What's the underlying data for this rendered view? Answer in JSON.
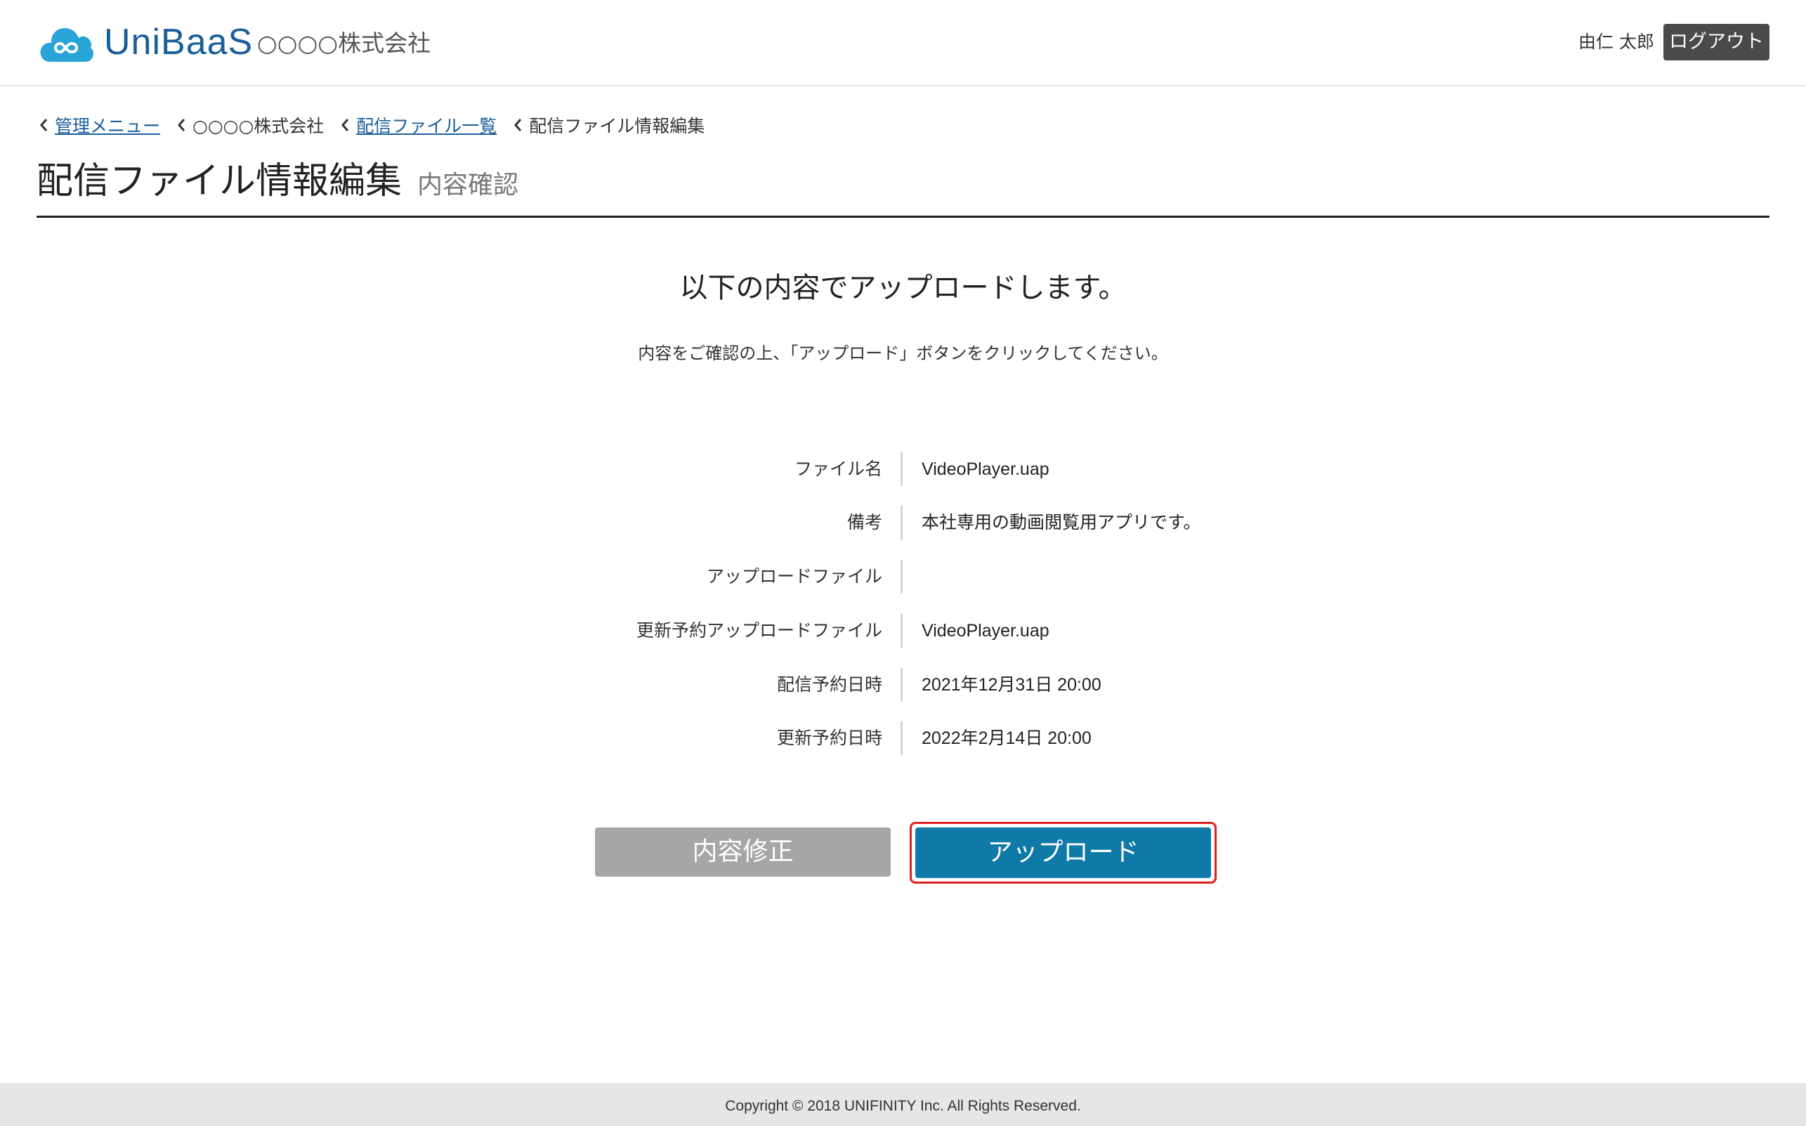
{
  "header": {
    "brand": "UniBaaS",
    "company": "○○○○株式会社",
    "user_name": "由仁 太郎",
    "logout_label": "ログアウト"
  },
  "breadcrumb": [
    {
      "label": "管理メニュー",
      "link": true
    },
    {
      "label": "○○○○株式会社",
      "link": false
    },
    {
      "label": "配信ファイル一覧",
      "link": true
    },
    {
      "label": "配信ファイル情報編集",
      "link": false
    }
  ],
  "page": {
    "title": "配信ファイル情報編集",
    "subtitle": "内容確認"
  },
  "lead": "以下の内容でアップロードします。",
  "note": "内容をご確認の上、「アップロード」ボタンをクリックしてください。",
  "details": [
    {
      "label": "ファイル名",
      "value": "VideoPlayer.uap"
    },
    {
      "label": "備考",
      "value": "本社専用の動画閲覧用アプリです。"
    },
    {
      "label": "アップロードファイル",
      "value": ""
    },
    {
      "label": "更新予約アップロードファイル",
      "value": "VideoPlayer.uap"
    },
    {
      "label": "配信予約日時",
      "value": "2021年12月31日 20:00"
    },
    {
      "label": "更新予約日時",
      "value": "2022年2月14日 20:00"
    }
  ],
  "buttons": {
    "edit_label": "内容修正",
    "upload_label": "アップロード"
  },
  "footer": {
    "copyright": "Copyright © 2018 UNIFINITY Inc. All Rights Reserved."
  },
  "colors": {
    "brand": "#1a5e9a",
    "logo_cloud": "#2aa3d8",
    "upload_button": "#0f7aa8",
    "edit_button": "#a6a6a6",
    "highlight_ring": "#e02020",
    "logout_button": "#4a4a4a"
  },
  "icons": {
    "logo": "cloud-infinity-icon",
    "breadcrumb_separator": "chevron-left-icon"
  }
}
